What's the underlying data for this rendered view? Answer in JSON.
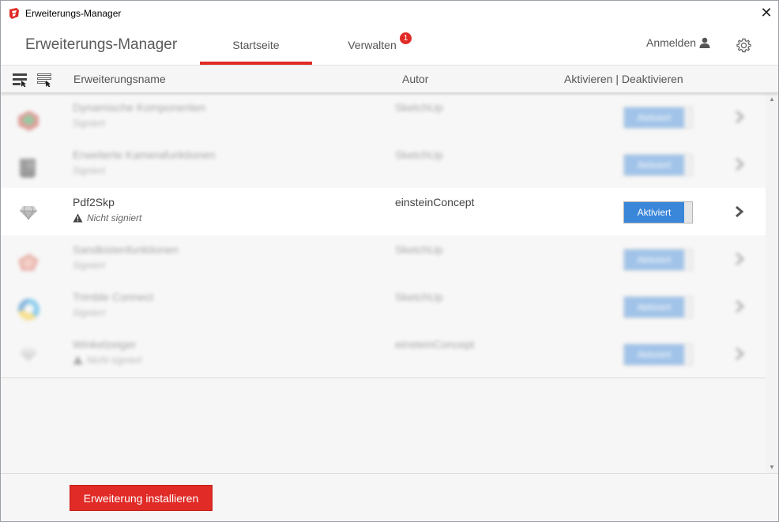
{
  "window": {
    "title": "Erweiterungs-Manager",
    "close_label": "✕"
  },
  "header": {
    "brand": "Erweiterungs-Manager",
    "tabs": [
      {
        "label": "Startseite",
        "active": true
      },
      {
        "label": "Verwalten",
        "badge": "1"
      }
    ],
    "signin_label": "Anmelden"
  },
  "columns": {
    "name": "Erweiterungsname",
    "author": "Autor",
    "toggle": "Aktivieren | Deaktivieren"
  },
  "extensions": [
    {
      "name": "Dynamische Komponenten",
      "subtitle": "Signiert",
      "author": "SketchUp",
      "toggle_label": "Aktiviert",
      "faded": true,
      "icon": "dynamic-components-icon"
    },
    {
      "name": "Erweiterte Kamerafunktionen",
      "subtitle": "Signiert",
      "author": "SketchUp",
      "toggle_label": "Aktiviert",
      "faded": true,
      "icon": "camera-tools-icon"
    },
    {
      "name": "Pdf2Skp",
      "subtitle": "Nicht signiert",
      "author": "einsteinConcept",
      "toggle_label": "Aktiviert",
      "faded": false,
      "icon": "diamond-icon"
    },
    {
      "name": "Sandkistenfunktionen",
      "subtitle": "Signiert",
      "author": "SketchUp",
      "toggle_label": "Aktiviert",
      "faded": true,
      "icon": "sandbox-icon"
    },
    {
      "name": "Trimble Connect",
      "subtitle": "Signiert",
      "author": "SketchUp",
      "toggle_label": "Aktiviert",
      "faded": true,
      "icon": "trimble-connect-icon"
    },
    {
      "name": "Winkelzeiger",
      "subtitle": "Nicht signiert",
      "author": "einsteinConcept",
      "toggle_label": "Aktiviert",
      "faded": true,
      "icon": "diamond-icon"
    }
  ],
  "footer": {
    "install_label": "Erweiterung installieren"
  },
  "colors": {
    "accent_red": "#e02b27",
    "toggle_blue": "#3a86d9"
  }
}
